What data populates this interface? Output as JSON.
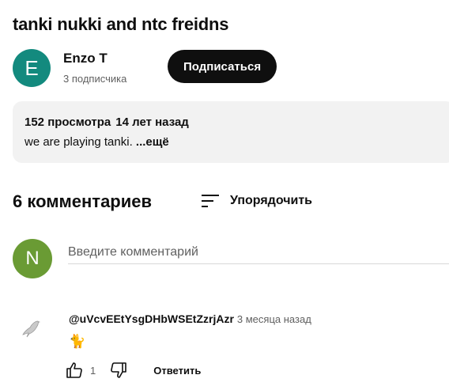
{
  "video": {
    "title": "tanki nukki and ntc freidns"
  },
  "channel": {
    "avatar_letter": "E",
    "name": "Enzo T",
    "subscribers": "3 подписчика",
    "subscribe_label": "Подписаться"
  },
  "description": {
    "views": "152 просмотра",
    "age": "14 лет назад",
    "text": "we are playing tanki. ",
    "more_label": "...ещё"
  },
  "comments": {
    "count_label": "6 комментариев",
    "sort_label": "Упорядочить",
    "input": {
      "avatar_letter": "N",
      "placeholder": "Введите комментарий"
    },
    "items": [
      {
        "author": "@uVcvEEtYsgDHbWSEtZzrjAzr",
        "time": "3 месяца назад",
        "text": "🐈",
        "likes": "1",
        "reply_label": "Ответить"
      }
    ]
  },
  "colors": {
    "channel_avatar": "#138a7e",
    "user_avatar": "#6a9b34",
    "subscribe_bg": "#0f0f0f"
  },
  "icons": [
    "sort-icon",
    "bird-avatar-icon",
    "thumbs-up-icon",
    "thumbs-down-icon"
  ]
}
